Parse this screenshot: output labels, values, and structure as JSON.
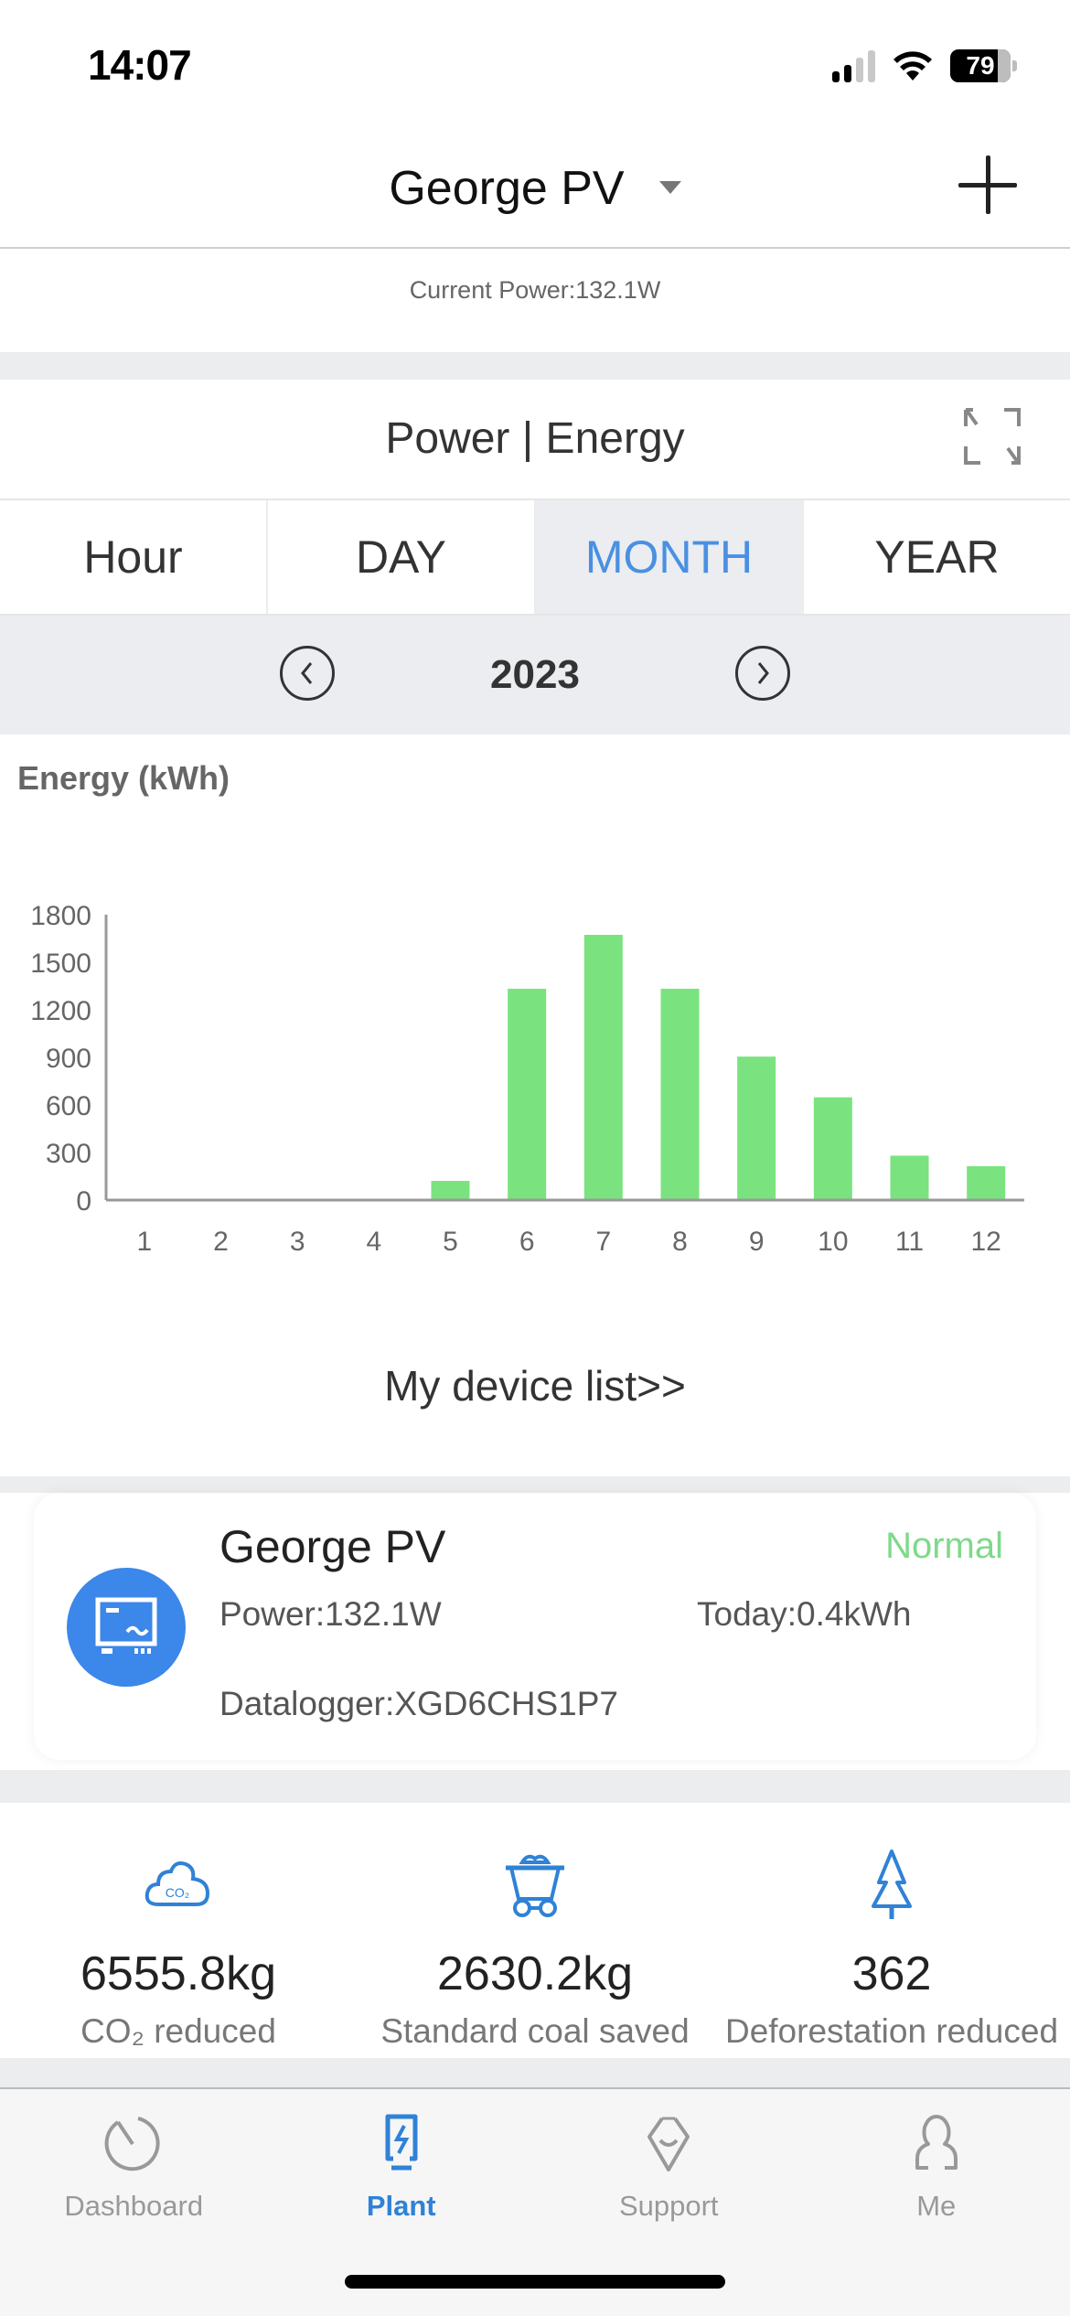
{
  "status_bar": {
    "time": "14:07",
    "battery": "79",
    "signal_bars_active": 2,
    "signal_bars_total": 4
  },
  "header": {
    "plant_name": "George PV",
    "add_label": "+"
  },
  "current_power": "Current Power:132.1W",
  "chart_card": {
    "title": "Power | Energy",
    "tabs": [
      {
        "label": "Hour",
        "active": false
      },
      {
        "label": "DAY",
        "active": false
      },
      {
        "label": "MONTH",
        "active": true
      },
      {
        "label": "YEAR",
        "active": false
      }
    ],
    "period": "2023"
  },
  "chart_data": {
    "type": "bar",
    "title": "",
    "ylabel": "Energy (kWh)",
    "xlabel": "",
    "categories": [
      "1",
      "2",
      "3",
      "4",
      "5",
      "6",
      "7",
      "8",
      "9",
      "10",
      "11",
      "12"
    ],
    "values": [
      0,
      0,
      0,
      0,
      121,
      1333,
      1673,
      1333,
      905,
      648,
      280,
      214
    ],
    "ylim": [
      0,
      1800
    ],
    "yticks": [
      0,
      300,
      600,
      900,
      1200,
      1500,
      1800
    ],
    "grid": false,
    "bar_color": "#7ae37f",
    "axis_color": "#999999"
  },
  "device_list_link": "My device list>>",
  "device": {
    "name": "George PV",
    "status": "Normal",
    "power": "Power:132.1W",
    "today": "Today:0.4kWh",
    "datalogger": "Datalogger:XGD6CHS1P7"
  },
  "eco": [
    {
      "icon": "co2-cloud-icon",
      "value": "6555.8kg",
      "label": "CO₂ reduced"
    },
    {
      "icon": "coal-cart-icon",
      "value": "2630.2kg",
      "label": "Standard coal saved"
    },
    {
      "icon": "tree-icon",
      "value": "362",
      "label": "Deforestation reduced"
    }
  ],
  "nav": [
    {
      "label": "Dashboard",
      "icon": "dashboard-icon",
      "active": false
    },
    {
      "label": "Plant",
      "icon": "plant-icon",
      "active": true
    },
    {
      "label": "Support",
      "icon": "support-icon",
      "active": false
    },
    {
      "label": "Me",
      "icon": "user-icon",
      "active": false
    }
  ],
  "colors": {
    "accent": "#4a90e2",
    "status_normal": "#7ed98a",
    "device_avatar": "#3b87ea",
    "icon_blue": "#2f82d6"
  }
}
